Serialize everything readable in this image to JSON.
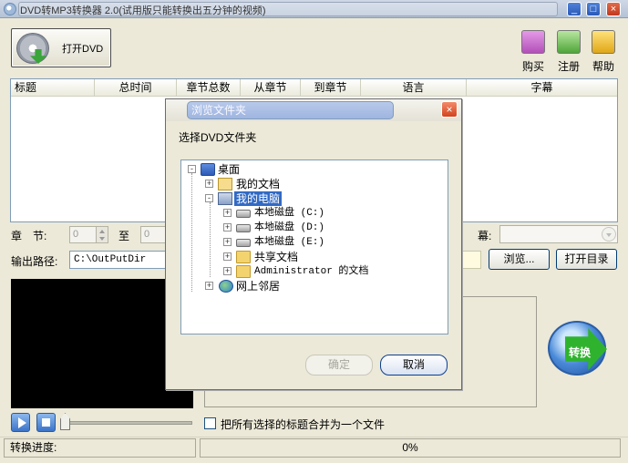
{
  "window": {
    "title": "DVD转MP3转换器 2.0(试用版只能转换出五分钟的视频)",
    "minimize": "_",
    "maximize": "□",
    "close": "×"
  },
  "toolbar": {
    "open_dvd": "打开DVD",
    "buy": "购买",
    "register": "注册",
    "help": "帮助"
  },
  "list": {
    "columns": [
      "标题",
      "总时间",
      "章节总数",
      "从章节",
      "到章节",
      "语言",
      "字幕"
    ],
    "rows": []
  },
  "controls": {
    "chapter_label": "章　节:",
    "chapter_from": "0",
    "to_label": "至",
    "chapter_to": "0",
    "subtitle_label": "幕:",
    "output_path_label": "输出路径:",
    "output_path": "C:\\OutPutDir",
    "browse_button": "浏览...",
    "open_dir_button": "打开目录",
    "convert_button": "转换",
    "merge_checkbox": "把所有选择的标题合并为一个文件",
    "merge_checked": false
  },
  "status": {
    "progress_label": "转换进度:",
    "progress_value": "0%"
  },
  "dialog": {
    "title": "浏览文件夹",
    "prompt": "选择DVD文件夹",
    "close": "×",
    "tree": [
      {
        "label": "桌面",
        "icon": "desktop-icon",
        "level": 0,
        "expander": "-"
      },
      {
        "label": "我的文档",
        "icon": "documents-icon",
        "level": 1,
        "expander": "+"
      },
      {
        "label": "我的电脑",
        "icon": "computer-icon",
        "level": 1,
        "expander": "-",
        "selected": true
      },
      {
        "label": "本地磁盘 (C:)",
        "icon": "disk-icon",
        "level": 2,
        "expander": "+"
      },
      {
        "label": "本地磁盘 (D:)",
        "icon": "disk-icon",
        "level": 2,
        "expander": "+"
      },
      {
        "label": "本地磁盘 (E:)",
        "icon": "disk-icon",
        "level": 2,
        "expander": "+"
      },
      {
        "label": "共享文档",
        "icon": "folder-icon",
        "level": 2,
        "expander": "+"
      },
      {
        "label": "Administrator 的文档",
        "icon": "folder-icon",
        "level": 2,
        "expander": "+"
      },
      {
        "label": "网上邻居",
        "icon": "network-icon",
        "level": 1,
        "expander": "+"
      }
    ],
    "ok_button": "确定",
    "cancel_button": "取消"
  },
  "colors": {
    "window_bg": "#ece9d8",
    "selection": "#316ac5",
    "preview_bg": "#000000"
  }
}
